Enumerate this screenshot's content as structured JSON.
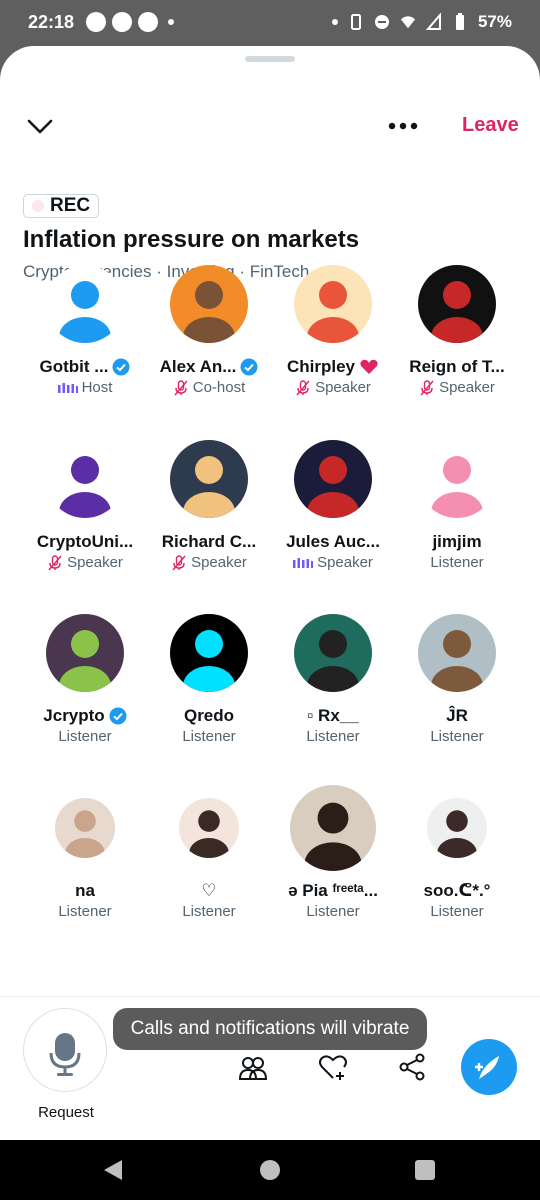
{
  "status_bar": {
    "time": "22:18",
    "battery": "57%"
  },
  "header": {
    "leave_label": "Leave"
  },
  "space": {
    "rec_label": "REC",
    "title": "Inflation pressure on markets",
    "topics": "Cryptocurrencies · Investing · FinTech"
  },
  "participants": [
    {
      "name": "Gotbit ...",
      "role": "Host",
      "verified": true,
      "role_icon": "speaking-bars-icon"
    },
    {
      "name": "Alex An...",
      "role": "Co-host",
      "verified": true,
      "role_icon": "mic-off-icon"
    },
    {
      "name": "Chirpley",
      "role": "Speaker",
      "verified": false,
      "role_icon": "mic-off-icon",
      "name_icon": "heart-icon"
    },
    {
      "name": "Reign of T...",
      "role": "Speaker",
      "verified": false,
      "role_icon": "mic-off-icon"
    },
    {
      "name": "CryptoUni...",
      "role": "Speaker",
      "verified": false,
      "role_icon": "mic-off-icon"
    },
    {
      "name": "Richard C...",
      "role": "Speaker",
      "verified": false,
      "role_icon": "mic-off-icon"
    },
    {
      "name": "Jules Auc...",
      "role": "Speaker",
      "verified": false,
      "role_icon": "speaking-bars-icon"
    },
    {
      "name": "jimjim",
      "role": "Listener",
      "verified": false
    },
    {
      "name": "Jcrypto",
      "role": "Listener",
      "verified": true
    },
    {
      "name": "Qredo",
      "role": "Listener",
      "verified": false
    },
    {
      "name": "▫ Rx__",
      "role": "Listener",
      "verified": false
    },
    {
      "name": "ĴR",
      "role": "Listener",
      "verified": false
    },
    {
      "name": "na",
      "role": "Listener",
      "verified": false
    },
    {
      "name": "♡",
      "role": "Listener",
      "verified": false
    },
    {
      "name": "ə Pia ᶠʳᵉᵉᵗᵃ...",
      "role": "Listener",
      "verified": false
    },
    {
      "name": "soo.ᕦ*.°",
      "role": "Listener",
      "verified": false
    }
  ],
  "bottom": {
    "request_label": "Request",
    "toast": "Calls and notifications will vibrate",
    "icons": [
      "people-icon",
      "heart-plus-icon",
      "share-icon",
      "compose-icon"
    ]
  },
  "colors": {
    "accent": "#1d9bf0",
    "leave": "#e0245e",
    "speaking": "#7856ff"
  }
}
